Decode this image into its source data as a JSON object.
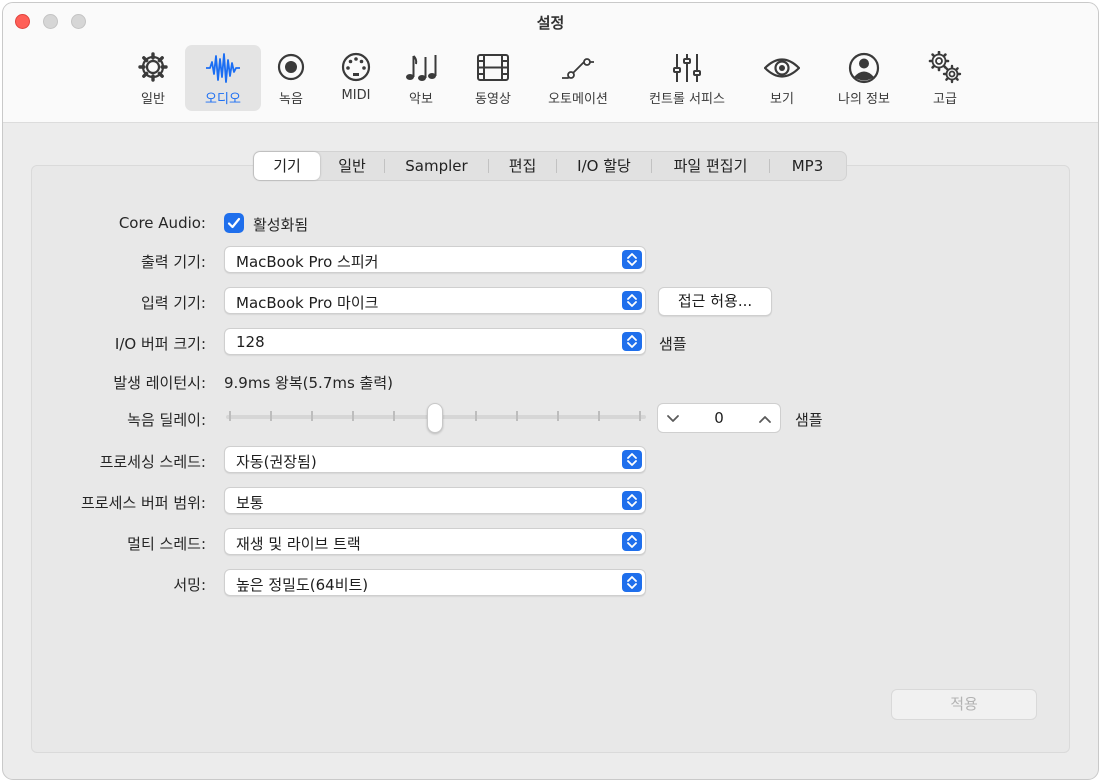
{
  "window": {
    "title": "설정"
  },
  "toolbar": {
    "items": [
      {
        "label": "일반",
        "icon": "gear-icon"
      },
      {
        "label": "오디오",
        "icon": "waveform-icon",
        "active": true
      },
      {
        "label": "녹음",
        "icon": "record-icon"
      },
      {
        "label": "MIDI",
        "icon": "midi-port-icon"
      },
      {
        "label": "악보",
        "icon": "music-notes-icon"
      },
      {
        "label": "동영상",
        "icon": "film-icon"
      },
      {
        "label": "오토메이션",
        "icon": "automation-curve-icon"
      },
      {
        "label": "컨트롤 서피스",
        "icon": "faders-icon"
      },
      {
        "label": "보기",
        "icon": "eye-icon"
      },
      {
        "label": "나의 정보",
        "icon": "person-circle-icon"
      },
      {
        "label": "고급",
        "icon": "gears-icon"
      }
    ],
    "accent_color": "#1b6ef3"
  },
  "tabs": [
    {
      "label": "기기",
      "selected": true
    },
    {
      "label": "일반"
    },
    {
      "label": "Sampler"
    },
    {
      "label": "편집"
    },
    {
      "label": "I/O 할당"
    },
    {
      "label": "파일 편집기"
    },
    {
      "label": "MP3"
    }
  ],
  "settings": {
    "core_audio": {
      "label": "Core Audio:",
      "checkbox_label": "활성화됨",
      "checked": true
    },
    "output_device": {
      "label": "출력 기기:",
      "value": "MacBook Pro 스피커"
    },
    "input_device": {
      "label": "입력 기기:",
      "value": "MacBook Pro 마이크",
      "button": "접근 허용..."
    },
    "io_buffer": {
      "label": "I/O 버퍼 크기:",
      "value": "128",
      "unit": "샘플"
    },
    "latency": {
      "label": "발생 레이턴시:",
      "value": "9.9ms 왕복(5.7ms 출력)"
    },
    "record_delay": {
      "label": "녹음 딜레이:",
      "value": "0",
      "unit": "샘플",
      "slider_fraction": 0.5
    },
    "processing_threads": {
      "label": "프로세싱 스레드:",
      "value": "자동(권장됨)"
    },
    "process_buffer": {
      "label": "프로세스 버퍼 범위:",
      "value": "보통"
    },
    "multithreading": {
      "label": "멀티 스레드:",
      "value": "재생 및 라이브 트랙"
    },
    "summing": {
      "label": "서밍:",
      "value": "높은 정밀도(64비트)"
    }
  },
  "apply_button": "적용"
}
